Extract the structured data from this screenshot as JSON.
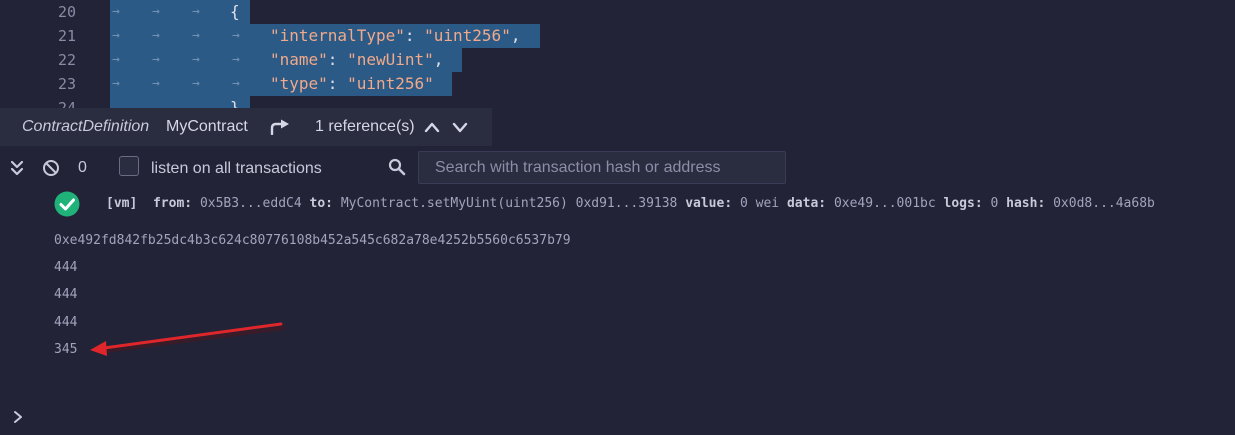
{
  "editor": {
    "lines": [
      {
        "num": "20",
        "content": "{"
      },
      {
        "num": "21",
        "key": "\"internalType\"",
        "sep": ": ",
        "value": "\"uint256\"",
        "trail": ","
      },
      {
        "num": "22",
        "key": "\"name\"",
        "sep": ": ",
        "value": "\"newUint\"",
        "trail": ","
      },
      {
        "num": "23",
        "key": "\"type\"",
        "sep": ": ",
        "value": "\"uint256\"",
        "trail": ""
      },
      {
        "num": "24",
        "content": "}"
      }
    ],
    "whitespace_glyph": "→"
  },
  "peek": {
    "kind": "ContractDefinition",
    "name": "MyContract",
    "references": "1 reference(s)"
  },
  "terminal": {
    "pending_count": "0",
    "listen_label": "listen on all transactions",
    "search_placeholder": "Search with transaction hash or address",
    "tx": {
      "tag": "[vm]",
      "from_label": "from:",
      "from": "0x5B3...eddC4",
      "to_label": "to:",
      "to": "MyContract.setMyUint(uint256) 0xd91...39138",
      "value_label": "value:",
      "value": "0 wei",
      "data_label": "data:",
      "data": "0xe49...001bc",
      "logs_label": "logs:",
      "logs": "0",
      "hash_label": "hash:",
      "hash": "0x0d8...4a68b"
    },
    "outputs": [
      "0xe492fd842fb25dc4b3c624c80776108b452a545c682a78e4252b5560c6537b79",
      "444",
      "444",
      "444",
      "345"
    ]
  },
  "colors": {
    "background": "#222336",
    "selection": "#2b5a86",
    "success": "#1fb37a",
    "annotation": "#e0262a"
  }
}
